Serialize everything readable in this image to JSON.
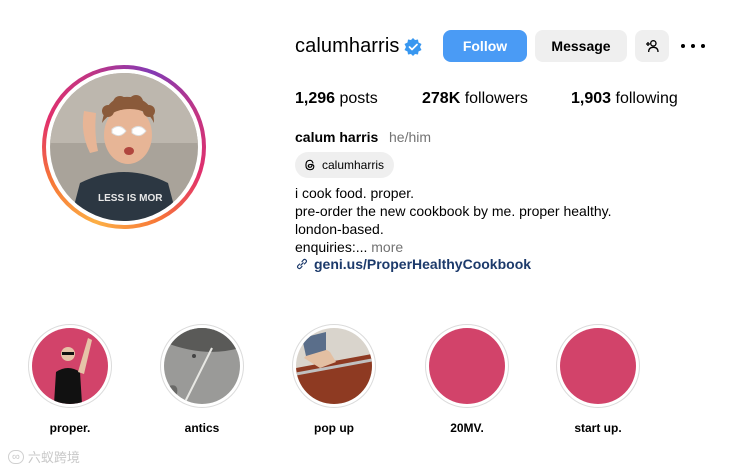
{
  "profile": {
    "username": "calumharris",
    "verified": true,
    "follow_label": "Follow",
    "message_label": "Message",
    "stats": {
      "posts_count": "1,296",
      "posts_label": "posts",
      "followers_count": "278K",
      "followers_label": "followers",
      "following_count": "1,903",
      "following_label": "following"
    },
    "full_name": "calum harris",
    "pronouns": "he/him",
    "threads_handle": "calumharris",
    "bio_lines": [
      "i cook food. proper.",
      "pre-order the new cookbook by me. proper healthy.",
      "london-based.",
      "enquiries:..."
    ],
    "bio_more": " more",
    "link": "geni.us/ProperHealthyCookbook"
  },
  "highlights": [
    {
      "label": "proper."
    },
    {
      "label": "antics"
    },
    {
      "label": "pop up"
    },
    {
      "label": "20MV."
    },
    {
      "label": "start up."
    }
  ],
  "colors": {
    "follow_button": "#4a9bf5",
    "secondary_button": "#efefef",
    "highlight_pink": "#d2436a",
    "verified_badge": "#3897f0",
    "link": "#1c3a6b"
  },
  "icons": {
    "verified": "verified-badge-icon",
    "add_user": "add-user-icon",
    "more": "more-options-icon",
    "threads": "threads-icon",
    "link": "link-icon"
  },
  "watermark": "六蚁跨境"
}
